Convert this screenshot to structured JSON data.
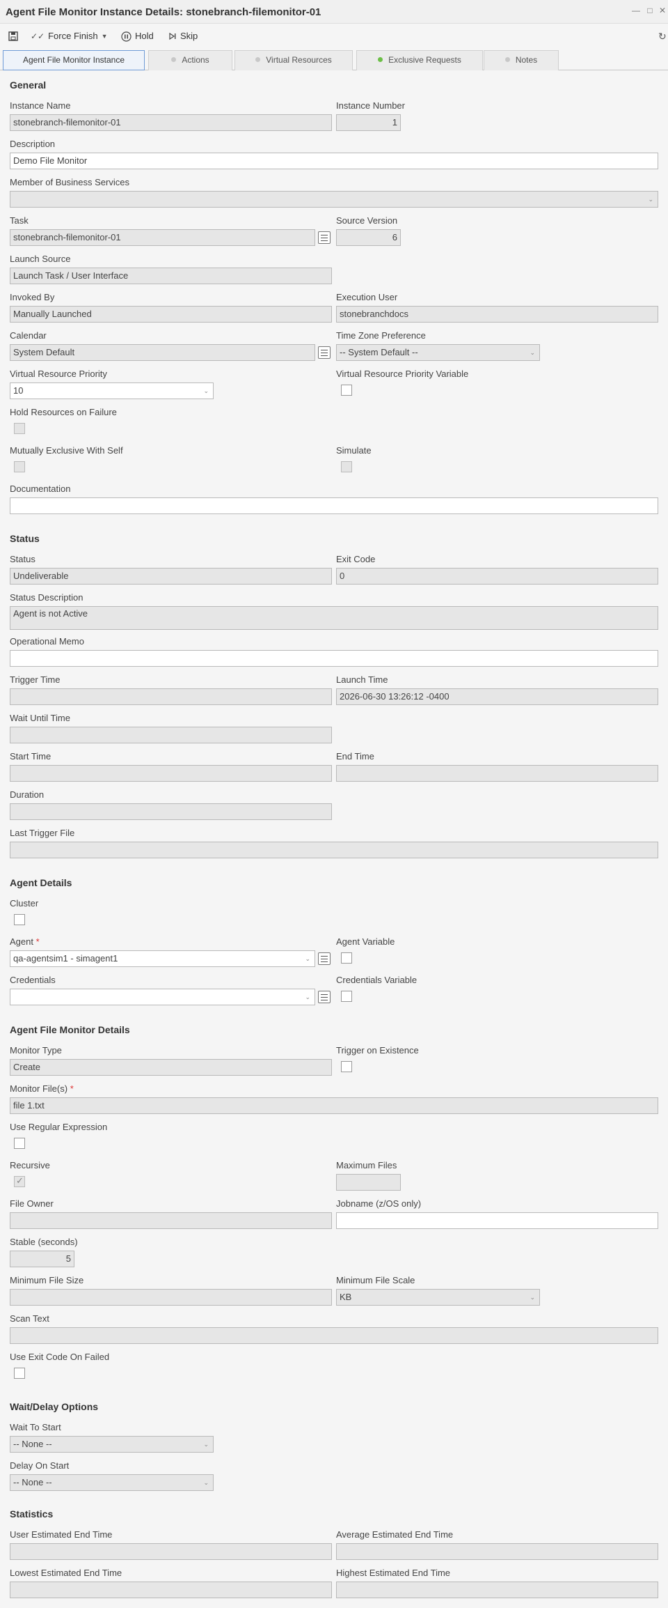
{
  "window": {
    "title": "Agent File Monitor Instance Details: stonebranch-filemonitor-01",
    "minimize_icon": "minimize-icon",
    "maximize_icon": "maximize-icon",
    "close_icon": "close-icon"
  },
  "toolbar": {
    "force_finish": "Force Finish",
    "hold": "Hold",
    "skip": "Skip"
  },
  "tabs": [
    {
      "label": "Agent File Monitor Instance"
    },
    {
      "label": "Actions"
    },
    {
      "label": "Virtual Resources"
    },
    {
      "label": "Exclusive Requests"
    },
    {
      "label": "Notes"
    }
  ],
  "general": {
    "section": "General",
    "instance_name_label": "Instance Name",
    "instance_name": "stonebranch-filemonitor-01",
    "instance_number_label": "Instance Number",
    "instance_number": "1",
    "description_label": "Description",
    "description": "Demo File Monitor",
    "business_services_label": "Member of Business Services",
    "business_services": "",
    "task_label": "Task",
    "task": "stonebranch-filemonitor-01",
    "source_version_label": "Source Version",
    "source_version": "6",
    "launch_source_label": "Launch Source",
    "launch_source": "Launch Task / User Interface",
    "invoked_by_label": "Invoked By",
    "invoked_by": "Manually Launched",
    "execution_user_label": "Execution User",
    "execution_user": "stonebranchdocs",
    "calendar_label": "Calendar",
    "calendar": "System Default",
    "time_zone_label": "Time Zone Preference",
    "time_zone": "-- System Default --",
    "vr_priority_label": "Virtual Resource Priority",
    "vr_priority": "10",
    "vr_priority_variable_label": "Virtual Resource Priority Variable",
    "hold_resources_label": "Hold Resources on Failure",
    "mutually_exclusive_label": "Mutually Exclusive With Self",
    "simulate_label": "Simulate",
    "documentation_label": "Documentation",
    "documentation": ""
  },
  "status": {
    "section": "Status",
    "status_label": "Status",
    "status": "Undeliverable",
    "exit_code_label": "Exit Code",
    "exit_code": "0",
    "status_description_label": "Status Description",
    "status_description": "Agent is not Active",
    "operational_memo_label": "Operational Memo",
    "operational_memo": "",
    "trigger_time_label": "Trigger Time",
    "trigger_time": "",
    "launch_time_label": "Launch Time",
    "launch_time": "2026-06-30 13:26:12 -0400",
    "wait_until_label": "Wait Until Time",
    "start_time_label": "Start Time",
    "end_time_label": "End Time",
    "duration_label": "Duration",
    "last_trigger_file_label": "Last Trigger File"
  },
  "agent": {
    "section": "Agent Details",
    "cluster_label": "Cluster",
    "agent_label": "Agent",
    "agent_required": "*",
    "agent": "qa-agentsim1 - simagent1",
    "agent_variable_label": "Agent Variable",
    "credentials_label": "Credentials",
    "credentials": "",
    "credentials_variable_label": "Credentials Variable"
  },
  "monitor": {
    "section": "Agent File Monitor Details",
    "monitor_type_label": "Monitor Type",
    "monitor_type": "Create",
    "trigger_existence_label": "Trigger on Existence",
    "monitor_files_label": "Monitor File(s)",
    "monitor_files_required": "*",
    "monitor_files": "file 1.txt",
    "use_regex_label": "Use Regular Expression",
    "recursive_label": "Recursive",
    "max_files_label": "Maximum Files",
    "file_owner_label": "File Owner",
    "jobname_label": "Jobname (z/OS only)",
    "stable_label": "Stable (seconds)",
    "stable": "5",
    "min_file_size_label": "Minimum File Size",
    "min_file_scale_label": "Minimum File Scale",
    "min_file_scale": "KB",
    "scan_text_label": "Scan Text",
    "use_exit_code_label": "Use Exit Code On Failed"
  },
  "wait": {
    "section": "Wait/Delay Options",
    "wait_to_start_label": "Wait To Start",
    "wait_to_start": "-- None --",
    "delay_on_start_label": "Delay On Start",
    "delay_on_start": "-- None --"
  },
  "statistics": {
    "section": "Statistics",
    "user_est_label": "User Estimated End Time",
    "avg_est_label": "Average Estimated End Time",
    "low_est_label": "Lowest Estimated End Time",
    "high_est_label": "Highest Estimated End Time"
  }
}
